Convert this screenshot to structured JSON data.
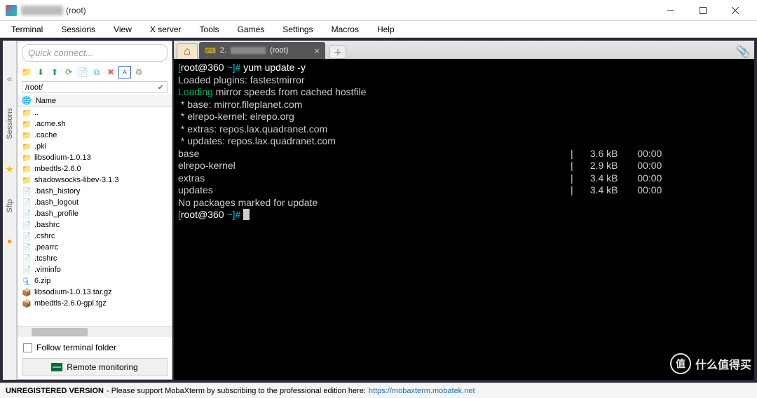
{
  "window": {
    "title_suffix": "(root)"
  },
  "menu": [
    "Terminal",
    "Sessions",
    "View",
    "X server",
    "Tools",
    "Games",
    "Settings",
    "Macros",
    "Help"
  ],
  "quick_connect_placeholder": "Quick connect...",
  "side_tabs": {
    "top": "Sessions",
    "bottom": "Sftp"
  },
  "path_bar": "/root/",
  "file_header": "Name",
  "files": [
    {
      "name": "..",
      "type": "up"
    },
    {
      "name": ".acme.sh",
      "type": "dotfolder"
    },
    {
      "name": ".cache",
      "type": "dotfolder"
    },
    {
      "name": ".pki",
      "type": "dotfolder"
    },
    {
      "name": "libsodium-1.0.13",
      "type": "folder"
    },
    {
      "name": "mbedtls-2.6.0",
      "type": "folder"
    },
    {
      "name": "shadowsocks-libev-3.1.3",
      "type": "folder"
    },
    {
      "name": ".bash_history",
      "type": "file"
    },
    {
      "name": ".bash_logout",
      "type": "file"
    },
    {
      "name": ".bash_profile",
      "type": "file"
    },
    {
      "name": ".bashrc",
      "type": "file"
    },
    {
      "name": ".cshrc",
      "type": "file"
    },
    {
      "name": ".pearrc",
      "type": "file"
    },
    {
      "name": ".tcshrc",
      "type": "file"
    },
    {
      "name": ".viminfo",
      "type": "file"
    },
    {
      "name": "6.zip",
      "type": "zip"
    },
    {
      "name": "libsodium-1.0.13.tar.gz",
      "type": "tar"
    },
    {
      "name": "mbedtls-2.6.0-gpl.tgz",
      "type": "tar"
    }
  ],
  "follow_label": "Follow terminal folder",
  "remote_mon_label": "Remote monitoring",
  "tabs": {
    "session_prefix": "2.",
    "session_suffix": "(root)"
  },
  "terminal": {
    "prompt1": {
      "open": "[",
      "user": "root@360",
      "path": " ~",
      "close": "]#",
      "cmd": " yum update -y"
    },
    "lines_plain": [
      "Loaded plugins: fastestmirror"
    ],
    "loading_line": {
      "pre": "Loading",
      "rest": " mirror speeds from cached hostfile"
    },
    "mirrors": [
      " * base: mirror.fileplanet.com",
      " * elrepo-kernel: elrepo.org",
      " * extras: repos.lax.quadranet.com",
      " * updates: repos.lax.quadranet.com"
    ],
    "repos": [
      {
        "name": "base",
        "size": "3.6 kB",
        "time": "00:00"
      },
      {
        "name": "elrepo-kernel",
        "size": "2.9 kB",
        "time": "00:00"
      },
      {
        "name": "extras",
        "size": "3.4 kB",
        "time": "00:00"
      },
      {
        "name": "updates",
        "size": "3.4 kB",
        "time": "00:00"
      }
    ],
    "no_update": "No packages marked for update",
    "prompt2": {
      "open": "[",
      "user": "root@360",
      "path": " ~",
      "close": "]# "
    }
  },
  "status": {
    "bold": "UNREGISTERED VERSION",
    "text": " - Please support MobaXterm by subscribing to the professional edition here: ",
    "link": "https://mobaxterm.mobatek.net"
  },
  "watermark": "什么值得买"
}
